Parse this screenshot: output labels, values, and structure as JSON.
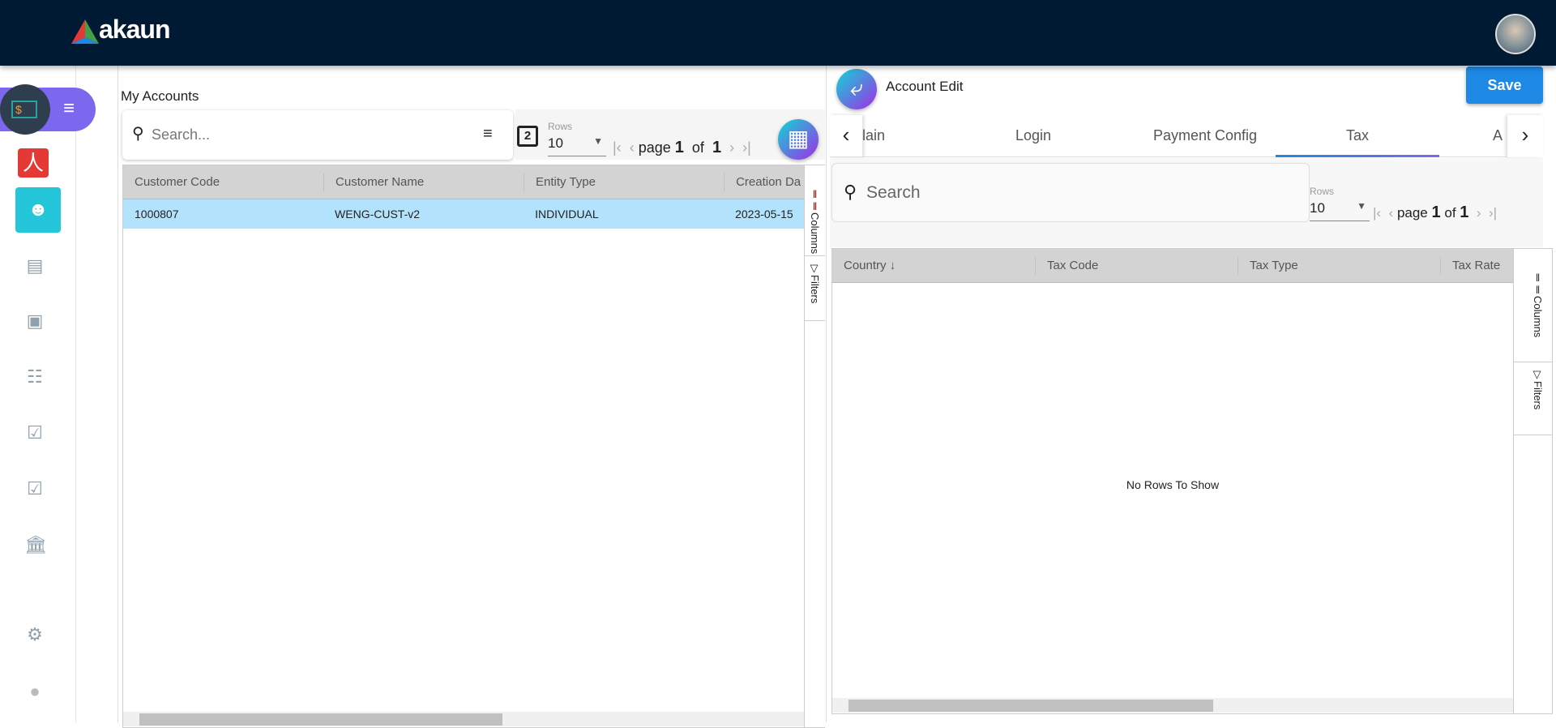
{
  "header": {
    "logo": "akaun"
  },
  "sidebar": {
    "items": [
      "app-switcher",
      "crm",
      "accounts",
      "cards",
      "payments",
      "receipts",
      "tasks-1",
      "tasks-2",
      "bank",
      "settings",
      "profile"
    ]
  },
  "left": {
    "title": "My Accounts",
    "search_placeholder": "Search...",
    "rows_label": "Rows",
    "rows_value": "10",
    "pager": {
      "page_word": "page",
      "page": "1",
      "of_word": "of",
      "total": "1"
    },
    "columns": [
      "Customer Code",
      "Customer Name",
      "Entity Type",
      "Creation Da"
    ],
    "rows": [
      [
        "1000807",
        "WENG-CUST-v2",
        "INDIVIDUAL",
        "2023-05-15"
      ]
    ],
    "side_tabs": {
      "columns": "Columns",
      "filters": "Filters"
    }
  },
  "right": {
    "title": "Account Edit",
    "save": "Save",
    "tabs": [
      "lain",
      "Login",
      "Payment Config",
      "Tax",
      "A"
    ],
    "active_tab": "Tax",
    "search_placeholder": "Search",
    "rows_label": "Rows",
    "rows_value": "10",
    "pager": {
      "page_word": "page",
      "page": "1",
      "of_word": "of",
      "total": "1"
    },
    "columns": [
      "Country",
      "Tax Code",
      "Tax Type",
      "Tax Rate"
    ],
    "empty": "No Rows To Show",
    "side_tabs": {
      "columns": "Columns",
      "filters": "Filters"
    }
  },
  "colors": {
    "header": "#001a33",
    "accent": "#1e88e5",
    "selected_row": "#b3e2fc",
    "active_sidebar": "#26c6da"
  }
}
